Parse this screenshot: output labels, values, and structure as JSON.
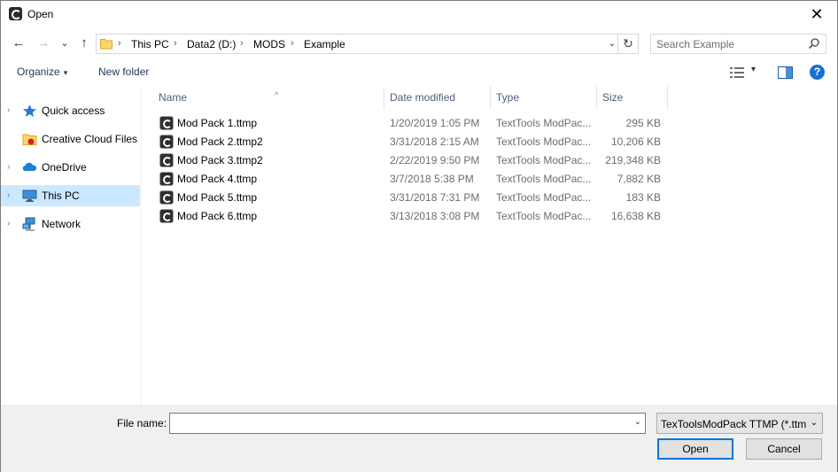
{
  "window": {
    "title": "Open",
    "close_glyph": "✕"
  },
  "nav": {
    "back_glyph": "←",
    "forward_glyph": "→",
    "recent_glyph": "⌄",
    "up_glyph": "↑",
    "breadcrumb": [
      "This PC",
      "Data2 (D:)",
      "MODS",
      "Example"
    ],
    "separator": "›",
    "dropdown_glyph": "⌄",
    "refresh_glyph": "↻"
  },
  "search": {
    "placeholder": "Search Example",
    "value": ""
  },
  "toolbar": {
    "organize_label": "Organize",
    "organize_caret": "▾",
    "new_folder_label": "New folder",
    "view_caret": "▾",
    "help_label": "?"
  },
  "sidebar": {
    "items": [
      {
        "label": "Quick access",
        "icon": "star-icon",
        "expandable": true,
        "selected": false
      },
      {
        "label": "Creative Cloud Files",
        "icon": "creative-cloud-folder-icon",
        "expandable": false,
        "selected": false
      },
      {
        "label": "OneDrive",
        "icon": "cloud-icon",
        "expandable": true,
        "selected": false
      },
      {
        "label": "This PC",
        "icon": "computer-icon",
        "expandable": true,
        "selected": true
      },
      {
        "label": "Network",
        "icon": "network-icon",
        "expandable": true,
        "selected": false
      }
    ],
    "chevron": "›"
  },
  "filelist": {
    "sort_glyph": "^",
    "columns": [
      "Name",
      "Date modified",
      "Type",
      "Size"
    ],
    "rows": [
      {
        "name": "Mod Pack 1.ttmp",
        "date": "1/20/2019 1:05 PM",
        "type": "TextTools ModPac...",
        "size": "295 KB"
      },
      {
        "name": "Mod Pack 2.ttmp2",
        "date": "3/31/2018 2:15 AM",
        "type": "TextTools ModPac...",
        "size": "10,206 KB"
      },
      {
        "name": "Mod Pack 3.ttmp2",
        "date": "2/22/2019 9:50 PM",
        "type": "TextTools ModPac...",
        "size": "219,348 KB"
      },
      {
        "name": "Mod Pack 4.ttmp",
        "date": "3/7/2018 5:38 PM",
        "type": "TextTools ModPac...",
        "size": "7,882 KB"
      },
      {
        "name": "Mod Pack 5.ttmp",
        "date": "3/31/2018 7:31 PM",
        "type": "TextTools ModPac...",
        "size": "183 KB"
      },
      {
        "name": "Mod Pack 6.ttmp",
        "date": "3/13/2018 3:08 PM",
        "type": "TextTools ModPac...",
        "size": "16,638 KB"
      }
    ]
  },
  "footer": {
    "file_name_label": "File name:",
    "file_name_value": "",
    "file_name_caret": "⌄",
    "filter_value": "TexToolsModPack TTMP (*.ttm",
    "filter_caret": "⌄",
    "open_label": "Open",
    "cancel_label": "Cancel"
  },
  "colors": {
    "accent": "#0078d7",
    "selection": "#cce8ff",
    "header_text": "#4c607a",
    "help_blue": "#1a6fd4"
  }
}
